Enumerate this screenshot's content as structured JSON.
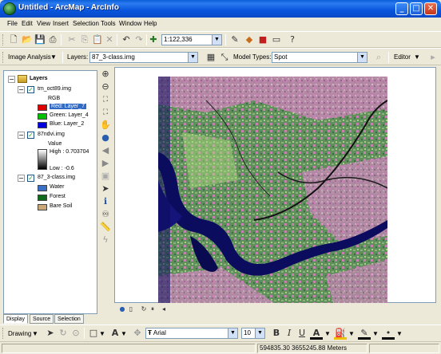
{
  "window": {
    "title": "Untitled - ArcMap - ArcInfo"
  },
  "menu": [
    "File",
    "Edit",
    "View",
    "Insert",
    "Selection",
    "Tools",
    "Window",
    "Help"
  ],
  "standard_toolbar": {
    "scale": "1:122,336"
  },
  "image_analysis_toolbar": {
    "menu_label": "Image Analysis",
    "layers_label": "Layers:",
    "layer_value": "87_3-class.img",
    "model_types_label": "Model Types:",
    "model_value": "Spot",
    "editor_label": "Editor"
  },
  "toc": {
    "root": "Layers",
    "layers": [
      {
        "name": "tm_oct89.img",
        "renderer": "RGB",
        "bands": [
          {
            "label": "Red:",
            "value": "Layer_7",
            "color": "#E00000"
          },
          {
            "label": "Green:",
            "value": "Layer_4",
            "color": "#00C000"
          },
          {
            "label": "Blue:",
            "value": "Layer_2",
            "color": "#0000E0"
          }
        ]
      },
      {
        "name": "87ndvi.img",
        "value_label": "Value",
        "high": "High : 0.703704",
        "low": "Low : -0.6"
      },
      {
        "name": "87_3-class.img",
        "classes": [
          {
            "label": "Water",
            "color": "#3A6FC8"
          },
          {
            "label": "Forest",
            "color": "#0F6B1A"
          },
          {
            "label": "Bare Soil",
            "color": "#C8A878"
          }
        ]
      }
    ]
  },
  "tabs": [
    "Display",
    "Source",
    "Selection"
  ],
  "drawing_toolbar": {
    "drawing_label": "Drawing",
    "font": "Arial",
    "font_size": "10",
    "bold": "B",
    "italic": "I",
    "underline": "U"
  },
  "status": {
    "coordinates": "594835.30  3655245.88 Meters"
  }
}
